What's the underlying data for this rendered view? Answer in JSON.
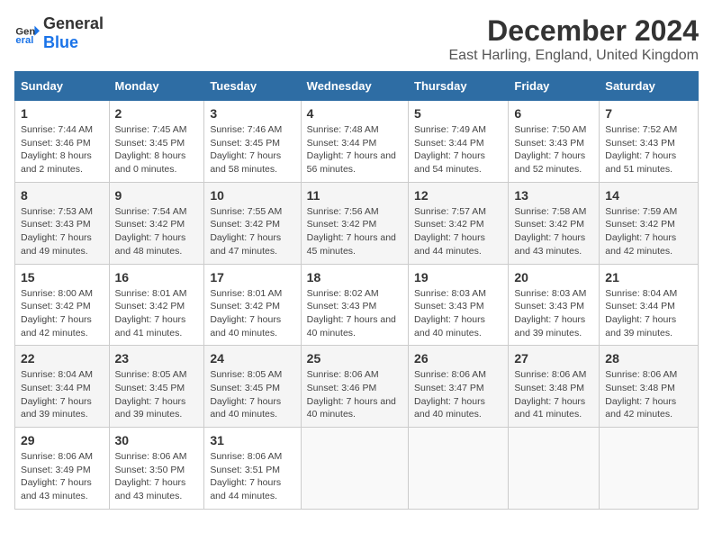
{
  "logo": {
    "text_general": "General",
    "text_blue": "Blue"
  },
  "title": "December 2024",
  "subtitle": "East Harling, England, United Kingdom",
  "days_of_week": [
    "Sunday",
    "Monday",
    "Tuesday",
    "Wednesday",
    "Thursday",
    "Friday",
    "Saturday"
  ],
  "weeks": [
    [
      {
        "day": "1",
        "sunrise": "Sunrise: 7:44 AM",
        "sunset": "Sunset: 3:46 PM",
        "daylight": "Daylight: 8 hours and 2 minutes."
      },
      {
        "day": "2",
        "sunrise": "Sunrise: 7:45 AM",
        "sunset": "Sunset: 3:45 PM",
        "daylight": "Daylight: 8 hours and 0 minutes."
      },
      {
        "day": "3",
        "sunrise": "Sunrise: 7:46 AM",
        "sunset": "Sunset: 3:45 PM",
        "daylight": "Daylight: 7 hours and 58 minutes."
      },
      {
        "day": "4",
        "sunrise": "Sunrise: 7:48 AM",
        "sunset": "Sunset: 3:44 PM",
        "daylight": "Daylight: 7 hours and 56 minutes."
      },
      {
        "day": "5",
        "sunrise": "Sunrise: 7:49 AM",
        "sunset": "Sunset: 3:44 PM",
        "daylight": "Daylight: 7 hours and 54 minutes."
      },
      {
        "day": "6",
        "sunrise": "Sunrise: 7:50 AM",
        "sunset": "Sunset: 3:43 PM",
        "daylight": "Daylight: 7 hours and 52 minutes."
      },
      {
        "day": "7",
        "sunrise": "Sunrise: 7:52 AM",
        "sunset": "Sunset: 3:43 PM",
        "daylight": "Daylight: 7 hours and 51 minutes."
      }
    ],
    [
      {
        "day": "8",
        "sunrise": "Sunrise: 7:53 AM",
        "sunset": "Sunset: 3:43 PM",
        "daylight": "Daylight: 7 hours and 49 minutes."
      },
      {
        "day": "9",
        "sunrise": "Sunrise: 7:54 AM",
        "sunset": "Sunset: 3:42 PM",
        "daylight": "Daylight: 7 hours and 48 minutes."
      },
      {
        "day": "10",
        "sunrise": "Sunrise: 7:55 AM",
        "sunset": "Sunset: 3:42 PM",
        "daylight": "Daylight: 7 hours and 47 minutes."
      },
      {
        "day": "11",
        "sunrise": "Sunrise: 7:56 AM",
        "sunset": "Sunset: 3:42 PM",
        "daylight": "Daylight: 7 hours and 45 minutes."
      },
      {
        "day": "12",
        "sunrise": "Sunrise: 7:57 AM",
        "sunset": "Sunset: 3:42 PM",
        "daylight": "Daylight: 7 hours and 44 minutes."
      },
      {
        "day": "13",
        "sunrise": "Sunrise: 7:58 AM",
        "sunset": "Sunset: 3:42 PM",
        "daylight": "Daylight: 7 hours and 43 minutes."
      },
      {
        "day": "14",
        "sunrise": "Sunrise: 7:59 AM",
        "sunset": "Sunset: 3:42 PM",
        "daylight": "Daylight: 7 hours and 42 minutes."
      }
    ],
    [
      {
        "day": "15",
        "sunrise": "Sunrise: 8:00 AM",
        "sunset": "Sunset: 3:42 PM",
        "daylight": "Daylight: 7 hours and 42 minutes."
      },
      {
        "day": "16",
        "sunrise": "Sunrise: 8:01 AM",
        "sunset": "Sunset: 3:42 PM",
        "daylight": "Daylight: 7 hours and 41 minutes."
      },
      {
        "day": "17",
        "sunrise": "Sunrise: 8:01 AM",
        "sunset": "Sunset: 3:42 PM",
        "daylight": "Daylight: 7 hours and 40 minutes."
      },
      {
        "day": "18",
        "sunrise": "Sunrise: 8:02 AM",
        "sunset": "Sunset: 3:43 PM",
        "daylight": "Daylight: 7 hours and 40 minutes."
      },
      {
        "day": "19",
        "sunrise": "Sunrise: 8:03 AM",
        "sunset": "Sunset: 3:43 PM",
        "daylight": "Daylight: 7 hours and 40 minutes."
      },
      {
        "day": "20",
        "sunrise": "Sunrise: 8:03 AM",
        "sunset": "Sunset: 3:43 PM",
        "daylight": "Daylight: 7 hours and 39 minutes."
      },
      {
        "day": "21",
        "sunrise": "Sunrise: 8:04 AM",
        "sunset": "Sunset: 3:44 PM",
        "daylight": "Daylight: 7 hours and 39 minutes."
      }
    ],
    [
      {
        "day": "22",
        "sunrise": "Sunrise: 8:04 AM",
        "sunset": "Sunset: 3:44 PM",
        "daylight": "Daylight: 7 hours and 39 minutes."
      },
      {
        "day": "23",
        "sunrise": "Sunrise: 8:05 AM",
        "sunset": "Sunset: 3:45 PM",
        "daylight": "Daylight: 7 hours and 39 minutes."
      },
      {
        "day": "24",
        "sunrise": "Sunrise: 8:05 AM",
        "sunset": "Sunset: 3:45 PM",
        "daylight": "Daylight: 7 hours and 40 minutes."
      },
      {
        "day": "25",
        "sunrise": "Sunrise: 8:06 AM",
        "sunset": "Sunset: 3:46 PM",
        "daylight": "Daylight: 7 hours and 40 minutes."
      },
      {
        "day": "26",
        "sunrise": "Sunrise: 8:06 AM",
        "sunset": "Sunset: 3:47 PM",
        "daylight": "Daylight: 7 hours and 40 minutes."
      },
      {
        "day": "27",
        "sunrise": "Sunrise: 8:06 AM",
        "sunset": "Sunset: 3:48 PM",
        "daylight": "Daylight: 7 hours and 41 minutes."
      },
      {
        "day": "28",
        "sunrise": "Sunrise: 8:06 AM",
        "sunset": "Sunset: 3:48 PM",
        "daylight": "Daylight: 7 hours and 42 minutes."
      }
    ],
    [
      {
        "day": "29",
        "sunrise": "Sunrise: 8:06 AM",
        "sunset": "Sunset: 3:49 PM",
        "daylight": "Daylight: 7 hours and 43 minutes."
      },
      {
        "day": "30",
        "sunrise": "Sunrise: 8:06 AM",
        "sunset": "Sunset: 3:50 PM",
        "daylight": "Daylight: 7 hours and 43 minutes."
      },
      {
        "day": "31",
        "sunrise": "Sunrise: 8:06 AM",
        "sunset": "Sunset: 3:51 PM",
        "daylight": "Daylight: 7 hours and 44 minutes."
      },
      null,
      null,
      null,
      null
    ]
  ]
}
